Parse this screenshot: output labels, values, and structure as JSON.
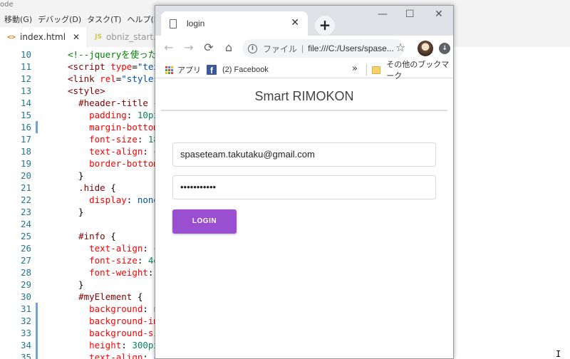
{
  "vscode": {
    "title_fragment": "ode",
    "menu": [
      "移動(G)",
      "デバッグ(D)",
      "タスク(T)",
      "ヘルプ(H)"
    ],
    "tabs": [
      {
        "icon": "<>",
        "label": "index.html",
        "close": "✕",
        "active": true
      },
      {
        "icon": "JS",
        "label": "obniz_start.js",
        "active": false
      }
    ],
    "line_numbers": [
      "10",
      "11",
      "12",
      "13",
      "14",
      "15",
      "16",
      "17",
      "18",
      "19",
      "20",
      "21",
      "22",
      "23",
      "24",
      "25",
      "26",
      "27",
      "28",
      "29",
      "30",
      "31",
      "32",
      "33",
      "34",
      "35"
    ]
  },
  "browser": {
    "tab_title": "login",
    "tab_close": "✕",
    "new_tab": "+",
    "window_controls": {
      "minimize": "—",
      "maximize": "☐",
      "close": "✕"
    },
    "nav": {
      "back": "←",
      "forward": "→",
      "reload": "⟳",
      "home": "⌂"
    },
    "omnibox": {
      "info": "i",
      "scheme": "ファイル",
      "separator": "|",
      "url": "file:///C:/Users/spase..."
    },
    "star": "☆",
    "ext": "↓",
    "bookmarks": {
      "apps_label": "アプリ",
      "facebook_label": "(2) Facebook",
      "more": "»",
      "other_label": "その他のブックマーク"
    }
  },
  "page": {
    "header_title": "Smart RIMOKON",
    "email_value": "spaseteam.takutaku@gmail.com",
    "password_value": "•••••••••••",
    "login_button": "LOGIN"
  },
  "colors": {
    "login_button": "#9a4fd0",
    "facebook": "#3b5998",
    "line_number": "#237893"
  },
  "cursor_glyph": "I"
}
